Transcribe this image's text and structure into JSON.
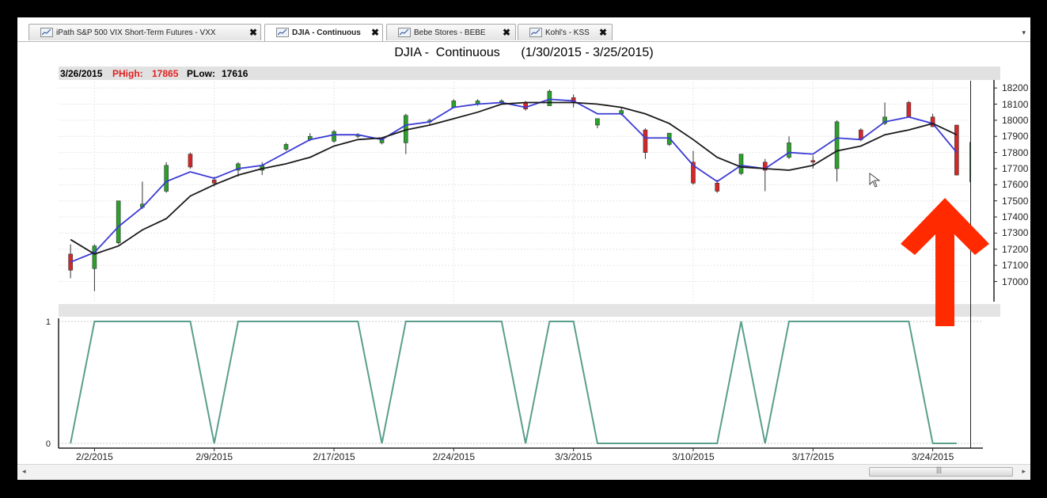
{
  "tabs": [
    {
      "label": "iPath S&P 500 VIX Short-Term Futures -  VXX",
      "active": false,
      "close": "✖"
    },
    {
      "label": "DJIA -  Continuous",
      "active": true,
      "close": "✖"
    },
    {
      "label": "Bebe Stores -  BEBE",
      "active": false,
      "close": "✖"
    },
    {
      "label": "Kohl's -  KSS",
      "active": false,
      "close": "✖"
    }
  ],
  "tab_dropdown": "▾",
  "chart_title": "DJIA -  Continuous      (1/30/2015 - 3/25/2015)",
  "info_bar": {
    "date": "3/26/2015",
    "phigh_label": "PHigh:",
    "phigh_value": "17865",
    "plow_label": "PLow:",
    "plow_value": "17616"
  },
  "colors": {
    "up_candle": "#2ca02c",
    "down_candle": "#d62728",
    "fast_ma": "#3b3bd6",
    "slow_ma": "#1a1a1a",
    "indicator": "#5a9e8c",
    "annotation_arrow": "#ff2a00",
    "phigh": "#e02020"
  },
  "scrollbar": {
    "left_arrow": "◂",
    "right_arrow": "▸",
    "grip": "|||"
  },
  "chart_data": [
    {
      "type": "candlestick",
      "title": "DJIA -  Continuous      (1/30/2015 - 3/25/2015)",
      "y_axis_ticks": [
        "18200",
        "18100",
        "18000",
        "17900",
        "17800",
        "17700",
        "17600",
        "17500",
        "17400",
        "17300",
        "17200",
        "17100",
        "17000"
      ],
      "ylim": [
        16870,
        18240
      ],
      "x_tick_labels": [
        "2/2/2015",
        "2/9/2015",
        "2/17/2015",
        "2/24/2015",
        "3/3/2015",
        "3/10/2015",
        "3/17/2015",
        "3/24/2015"
      ],
      "x_tick_index": [
        1,
        6,
        11,
        16,
        21,
        26,
        31,
        36
      ],
      "candles": [
        {
          "date": "1/30/2015",
          "open": 17170,
          "high": 17230,
          "low": 17020,
          "close": 17070
        },
        {
          "date": "2/2/2015",
          "open": 17080,
          "high": 17230,
          "low": 16940,
          "close": 17220
        },
        {
          "date": "2/3/2015",
          "open": 17240,
          "high": 17500,
          "low": 17230,
          "close": 17500
        },
        {
          "date": "2/4/2015",
          "open": 17460,
          "high": 17620,
          "low": 17450,
          "close": 17480
        },
        {
          "date": "2/5/2015",
          "open": 17560,
          "high": 17740,
          "low": 17550,
          "close": 17720
        },
        {
          "date": "2/6/2015",
          "open": 17790,
          "high": 17800,
          "low": 17700,
          "close": 17710
        },
        {
          "date": "2/9/2015",
          "open": 17630,
          "high": 17650,
          "low": 17590,
          "close": 17610
        },
        {
          "date": "2/10/2015",
          "open": 17690,
          "high": 17740,
          "low": 17650,
          "close": 17730
        },
        {
          "date": "2/11/2015",
          "open": 17690,
          "high": 17740,
          "low": 17660,
          "close": 17720
        },
        {
          "date": "2/12/2015",
          "open": 17820,
          "high": 17860,
          "low": 17810,
          "close": 17850
        },
        {
          "date": "2/13/2015",
          "open": 17880,
          "high": 17920,
          "low": 17870,
          "close": 17900
        },
        {
          "date": "2/17/2015",
          "open": 17870,
          "high": 17940,
          "low": 17860,
          "close": 17930
        },
        {
          "date": "2/18/2015",
          "open": 17900,
          "high": 17920,
          "low": 17890,
          "close": 17910
        },
        {
          "date": "2/19/2015",
          "open": 17860,
          "high": 17890,
          "low": 17850,
          "close": 17880
        },
        {
          "date": "2/20/2015",
          "open": 17860,
          "high": 18040,
          "low": 17790,
          "close": 18030
        },
        {
          "date": "2/23/2015",
          "open": 17990,
          "high": 18010,
          "low": 17970,
          "close": 18000
        },
        {
          "date": "2/24/2015",
          "open": 18080,
          "high": 18130,
          "low": 18080,
          "close": 18120
        },
        {
          "date": "2/25/2015",
          "open": 18100,
          "high": 18130,
          "low": 18090,
          "close": 18120
        },
        {
          "date": "2/26/2015",
          "open": 18110,
          "high": 18130,
          "low": 18100,
          "close": 18120
        },
        {
          "date": "2/27/2015",
          "open": 18110,
          "high": 18120,
          "low": 18060,
          "close": 18070
        },
        {
          "date": "3/2/2015",
          "open": 18090,
          "high": 18190,
          "low": 18090,
          "close": 18180
        },
        {
          "date": "3/3/2015",
          "open": 18140,
          "high": 18160,
          "low": 18080,
          "close": 18110
        },
        {
          "date": "3/4/2015",
          "open": 17970,
          "high": 17980,
          "low": 17950,
          "close": 18010
        },
        {
          "date": "3/5/2015",
          "open": 18040,
          "high": 18080,
          "low": 18030,
          "close": 18060
        },
        {
          "date": "3/6/2015",
          "open": 17940,
          "high": 17950,
          "low": 17760,
          "close": 17800
        },
        {
          "date": "3/9/2015",
          "open": 17850,
          "high": 17920,
          "low": 17840,
          "close": 17920
        },
        {
          "date": "3/10/2015",
          "open": 17740,
          "high": 17810,
          "low": 17600,
          "close": 17610
        },
        {
          "date": "3/11/2015",
          "open": 17610,
          "high": 17630,
          "low": 17550,
          "close": 17560
        },
        {
          "date": "3/12/2015",
          "open": 17670,
          "high": 17790,
          "low": 17660,
          "close": 17790
        },
        {
          "date": "3/13/2015",
          "open": 17740,
          "high": 17760,
          "low": 17560,
          "close": 17690
        },
        {
          "date": "3/16/2015",
          "open": 17770,
          "high": 17900,
          "low": 17760,
          "close": 17860
        },
        {
          "date": "3/17/2015",
          "open": 17750,
          "high": 17780,
          "low": 17700,
          "close": 17740
        },
        {
          "date": "3/18/2015",
          "open": 17700,
          "high": 18000,
          "low": 17620,
          "close": 17990
        },
        {
          "date": "3/19/2015",
          "open": 17940,
          "high": 17950,
          "low": 17870,
          "close": 17880
        },
        {
          "date": "3/20/2015",
          "open": 17980,
          "high": 18110,
          "low": 17970,
          "close": 18020
        },
        {
          "date": "3/23/2015",
          "open": 18110,
          "high": 18120,
          "low": 18020,
          "close": 18020
        },
        {
          "date": "3/24/2015",
          "open": 18020,
          "high": 18040,
          "low": 17960,
          "close": 17960
        },
        {
          "date": "3/25/2015",
          "open": 17970,
          "high": 17970,
          "low": 17660,
          "close": 17660
        }
      ],
      "last_bar": {
        "date": "3/26/2015",
        "high": 17865,
        "low": 17616
      },
      "series": [
        {
          "type": "line",
          "values": [
            17120,
            17180,
            17340,
            17460,
            17620,
            17680,
            17640,
            17700,
            17720,
            17800,
            17880,
            17910,
            17910,
            17880,
            17970,
            17990,
            18080,
            18100,
            18110,
            18080,
            18130,
            18120,
            18040,
            18040,
            17890,
            17890,
            17720,
            17620,
            17720,
            17700,
            17800,
            17790,
            17890,
            17880,
            17990,
            18020,
            17980,
            17800
          ]
        },
        {
          "type": "line",
          "values": [
            17260,
            17170,
            17220,
            17320,
            17390,
            17530,
            17600,
            17660,
            17700,
            17730,
            17770,
            17840,
            17880,
            17890,
            17940,
            17970,
            18010,
            18050,
            18100,
            18110,
            18110,
            18110,
            18100,
            18080,
            18040,
            17980,
            17880,
            17770,
            17710,
            17700,
            17690,
            17720,
            17810,
            17840,
            17910,
            17940,
            17980,
            17910
          ]
        }
      ]
    },
    {
      "type": "line",
      "y_axis_ticks": [
        "1",
        "0"
      ],
      "ylim": [
        0,
        1
      ],
      "x": [
        0,
        1,
        2,
        3,
        4,
        5,
        6,
        7,
        8,
        9,
        10,
        11,
        12,
        13,
        14,
        15,
        16,
        17,
        18,
        19,
        20,
        21,
        22,
        23,
        24,
        25,
        26,
        27,
        28,
        29,
        30,
        31,
        32,
        33,
        34,
        35,
        36,
        37
      ],
      "values": [
        0,
        1,
        1,
        1,
        1,
        1,
        0,
        1,
        1,
        1,
        1,
        1,
        1,
        0,
        1,
        1,
        1,
        1,
        1,
        0,
        1,
        1,
        0,
        0,
        0,
        0,
        0,
        0,
        1,
        0,
        1,
        1,
        1,
        1,
        1,
        1,
        0,
        0
      ]
    }
  ]
}
